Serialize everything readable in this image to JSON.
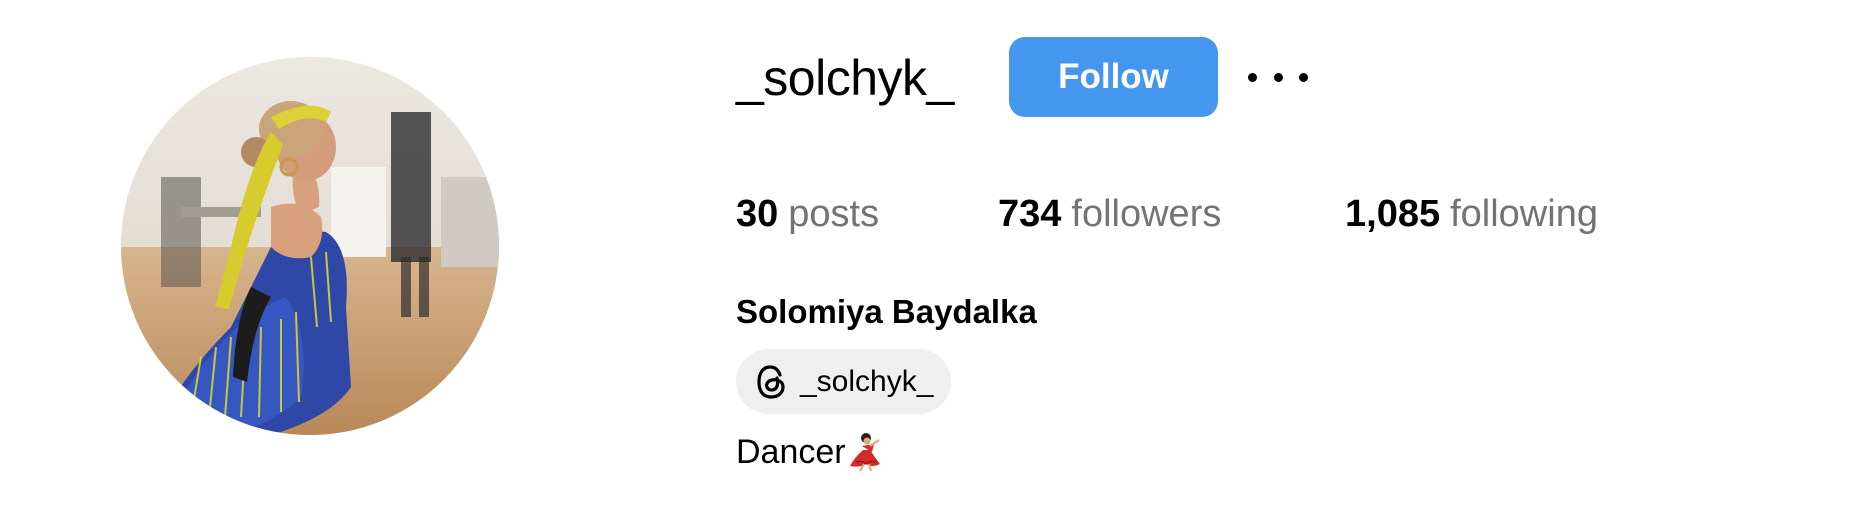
{
  "profile": {
    "username": "_solchyk_",
    "full_name": "Solomiya Baydalka",
    "avatar_icon": "profile-photo-dancer",
    "follow_label": "Follow",
    "more_icon": "more-options-icon",
    "stats": {
      "posts_count": "30",
      "posts_label": "posts",
      "followers_count": "734",
      "followers_label": "followers",
      "following_count": "1,085",
      "following_label": "following"
    },
    "threads": {
      "icon": "threads-icon",
      "handle": "_solchyk_"
    },
    "bio": {
      "text": "Dancer",
      "emoji": "dancer-emoji"
    }
  },
  "colors": {
    "follow_button": "#4596ee",
    "stat_label": "#737373",
    "chip_background": "#efefef"
  }
}
